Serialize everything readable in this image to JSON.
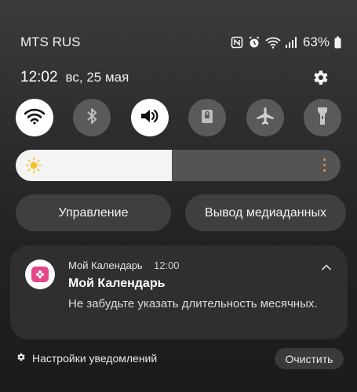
{
  "status_bar": {
    "carrier": "MTS RUS",
    "battery_percent": "63%",
    "icons": [
      "nfc-icon",
      "alarm-icon",
      "wifi-icon",
      "signal-icon",
      "battery-icon"
    ]
  },
  "header": {
    "time": "12:02",
    "date": "вс, 25 мая"
  },
  "quick_toggles": [
    {
      "name": "wifi",
      "icon": "wifi-icon",
      "state": "on"
    },
    {
      "name": "bluetooth",
      "icon": "bluetooth-icon",
      "state": "off"
    },
    {
      "name": "sound",
      "icon": "speaker-icon",
      "state": "on"
    },
    {
      "name": "rotation-lock",
      "icon": "lock-icon",
      "state": "off"
    },
    {
      "name": "airplane",
      "icon": "airplane-icon",
      "state": "off"
    },
    {
      "name": "flashlight",
      "icon": "flashlight-icon",
      "state": "off"
    }
  ],
  "brightness": {
    "level": 0.48,
    "accent_color": "#ff8a3d"
  },
  "buttons": {
    "control": "Управление",
    "media_output": "Вывод медиаданных"
  },
  "notification": {
    "app_name": "Мой Календарь",
    "time": "12:00",
    "title": "Мой Календарь",
    "body": "Не забудьте указать длительность месячных.",
    "app_color": "#e4468a"
  },
  "footer": {
    "settings_label": "Настройки уведомлений",
    "clear_label": "Очистить"
  }
}
